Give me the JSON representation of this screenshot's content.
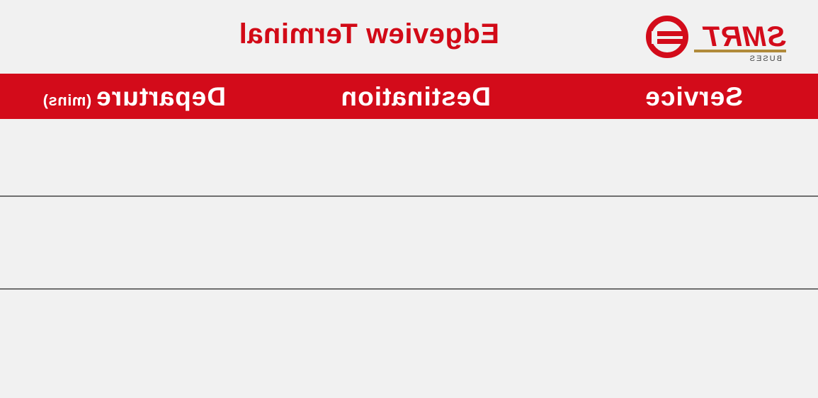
{
  "title": "Edgeview Terminal",
  "logo": {
    "brand_text": "SMRT",
    "sub_text": "BUSES",
    "icon": "smrt-logo-icon"
  },
  "table": {
    "headers": {
      "service": "Service",
      "destination": "Destination",
      "departure": "Departure",
      "departure_unit": "(mins)"
    },
    "rows": [
      {
        "service": "",
        "destination": "",
        "departure": ""
      },
      {
        "service": "",
        "destination": "",
        "departure": ""
      },
      {
        "service": "",
        "destination": "",
        "departure": ""
      }
    ]
  },
  "colors": {
    "accent_red": "#d30b1a",
    "background": "#f1f1f1",
    "divider": "#6f6f6f",
    "logo_gold": "#b08a3a"
  },
  "orientation": "mirrored-horizontally"
}
